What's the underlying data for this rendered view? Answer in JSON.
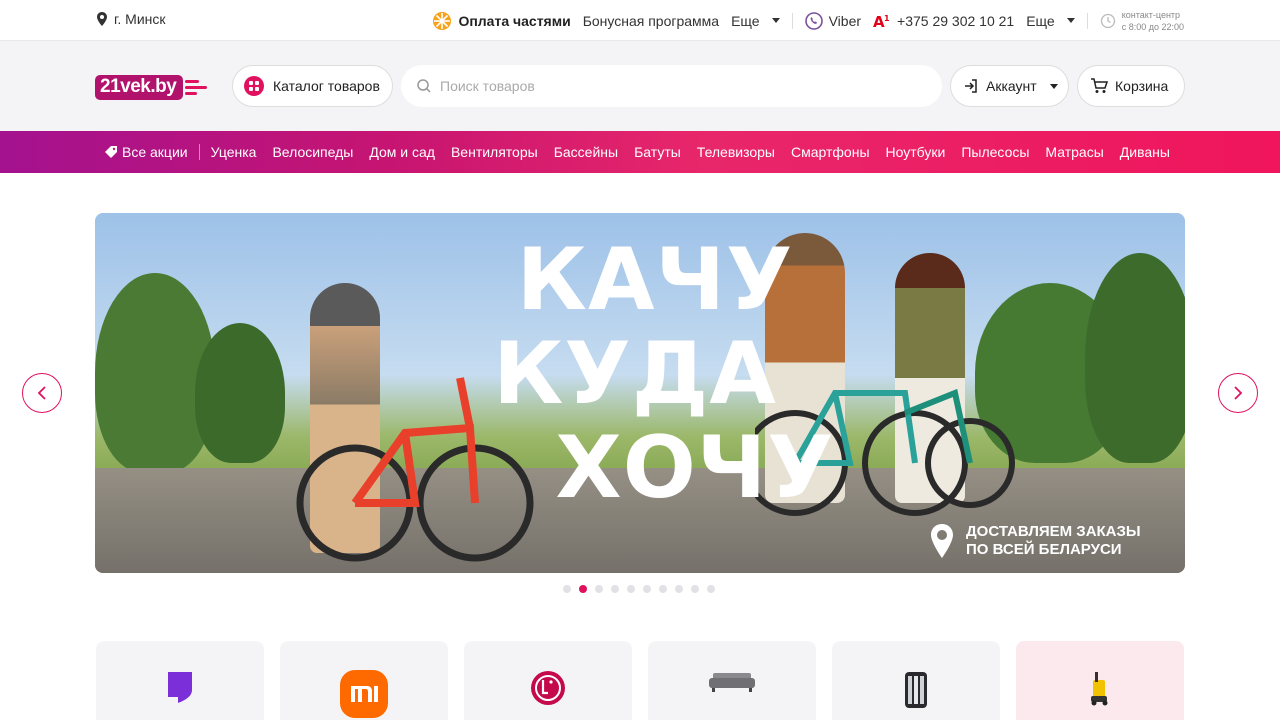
{
  "topbar": {
    "city": "г. Минск",
    "installments": "Оплата частями",
    "bonus": "Бонусная программа",
    "more1": "Еще",
    "viber": "Viber",
    "phone": "+375 29 302 10 21",
    "more2": "Еще",
    "contact_line1": "контакт-центр",
    "contact_line2": "с 8:00 до 22:00"
  },
  "header": {
    "logo": "21vek.by",
    "catalog_label": "Каталог товаров",
    "search_placeholder": "Поиск товаров",
    "account_label": "Аккаунт",
    "cart_label": "Корзина"
  },
  "catnav": {
    "items": [
      "Все акции",
      "Уценка",
      "Велосипеды",
      "Дом и сад",
      "Вентиляторы",
      "Бассейны",
      "Батуты",
      "Телевизоры",
      "Смартфоны",
      "Ноутбуки",
      "Пылесосы",
      "Матрасы",
      "Диваны"
    ]
  },
  "banner": {
    "line1": "КАЧУ",
    "line2": "КУДА",
    "line3": "ХОЧУ",
    "delivery1": "ДОСТАВЛЯЕМ ЗАКАЗЫ",
    "delivery2": "ПО ВСЕЙ БЕЛАРУСИ",
    "slides_total": 10,
    "active_slide": 2
  },
  "colors": {
    "accent": "#e0115f",
    "logo": "#b0126c",
    "nav_start": "#a4128f",
    "nav_end": "#f0155d"
  },
  "tiles": {
    "icons": [
      "brand-purple-icon",
      "xiaomi-mi-icon",
      "lg-logo-icon",
      "sofa-icon",
      "shower-cabin-icon",
      "pressure-washer-icon"
    ]
  }
}
